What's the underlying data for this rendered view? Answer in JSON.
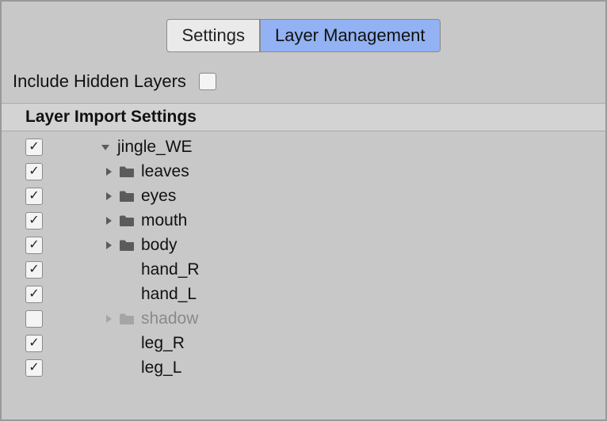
{
  "tabs": {
    "settings": "Settings",
    "layer_mgmt": "Layer Management",
    "active": "layer_mgmt"
  },
  "option": {
    "include_hidden_label": "Include Hidden Layers",
    "include_hidden_checked": false
  },
  "section": {
    "title": "Layer Import Settings"
  },
  "tree": [
    {
      "checked": true,
      "depth": 0,
      "arrow": "down",
      "folder": false,
      "label": "jingle_WE",
      "faded": false
    },
    {
      "checked": true,
      "depth": 1,
      "arrow": "right",
      "folder": true,
      "label": "leaves",
      "faded": false
    },
    {
      "checked": true,
      "depth": 1,
      "arrow": "right",
      "folder": true,
      "label": "eyes",
      "faded": false
    },
    {
      "checked": true,
      "depth": 1,
      "arrow": "right",
      "folder": true,
      "label": "mouth",
      "faded": false
    },
    {
      "checked": true,
      "depth": 1,
      "arrow": "right",
      "folder": true,
      "label": "body",
      "faded": false
    },
    {
      "checked": true,
      "depth": 1,
      "arrow": null,
      "folder": false,
      "label": "hand_R",
      "faded": false
    },
    {
      "checked": true,
      "depth": 1,
      "arrow": null,
      "folder": false,
      "label": "hand_L",
      "faded": false
    },
    {
      "checked": false,
      "depth": 1,
      "arrow": "right",
      "folder": true,
      "label": "shadow",
      "faded": true
    },
    {
      "checked": true,
      "depth": 1,
      "arrow": null,
      "folder": false,
      "label": "leg_R",
      "faded": false
    },
    {
      "checked": true,
      "depth": 1,
      "arrow": null,
      "folder": false,
      "label": "leg_L",
      "faded": false
    }
  ]
}
